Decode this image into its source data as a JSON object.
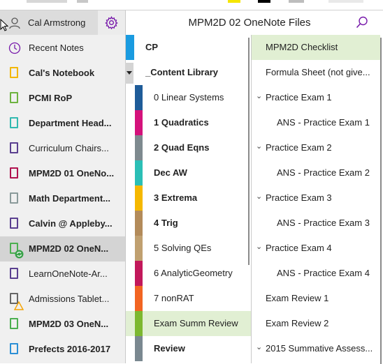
{
  "user": {
    "name": "Cal Armstrong"
  },
  "notebooks": {
    "recent": "Recent Notes",
    "items": [
      {
        "label": "Cal's Notebook",
        "color": "#f3b700",
        "bold": true
      },
      {
        "label": "PCMI RoP",
        "color": "#6db33f",
        "bold": true
      },
      {
        "label": "Department Head...",
        "color": "#32b9b0",
        "bold": true
      },
      {
        "label": "Curriculum Chairs...",
        "color": "#5a3f8f",
        "bold": false
      },
      {
        "label": "MPM2D 01 OneNo...",
        "color": "#b0124f",
        "bold": true
      },
      {
        "label": "Math Department...",
        "color": "#8a9a9a",
        "bold": true
      },
      {
        "label": "Calvin @ Appleby...",
        "color": "#5a3f8f",
        "bold": true
      },
      {
        "label": "MPM2D 02 OneN...",
        "color": "#4caf50",
        "bold": true,
        "selected": true
      },
      {
        "label": "LearnOneNote-Ar...",
        "color": "#5a3f8f",
        "bold": false
      },
      {
        "label": "Admissions Tablet...",
        "color": "#666666",
        "bold": false
      },
      {
        "label": "MPM2D 03 OneN...",
        "color": "#4caf50",
        "bold": true
      },
      {
        "label": "Prefects 2016-2017",
        "color": "#2b8fd6",
        "bold": true
      }
    ]
  },
  "header": {
    "title": "MPM2D 02 OneNote Files"
  },
  "sections": [
    {
      "label": "CP",
      "color": "#1a9be0",
      "bold": true,
      "group": true
    },
    {
      "label": "_Content Library",
      "color": "#f0f0f0",
      "bold": true,
      "group": true
    },
    {
      "label": "0 Linear Systems",
      "color": "#1f5c99",
      "bold": false
    },
    {
      "label": "1 Quadratics",
      "color": "#d4127b",
      "bold": true
    },
    {
      "label": "2 Quad Eqns",
      "color": "#7e8a8f",
      "bold": true
    },
    {
      "label": "Dec AW",
      "color": "#2bbfb6",
      "bold": true
    },
    {
      "label": "3 Extrema",
      "color": "#f5b800",
      "bold": true
    },
    {
      "label": "4 Trig",
      "color": "#b38b5a",
      "bold": true
    },
    {
      "label": "5 Solving QEs",
      "color": "#c0a070",
      "bold": false
    },
    {
      "label": "6 AnalyticGeometry",
      "color": "#c2185b",
      "bold": false
    },
    {
      "label": "7 nonRAT",
      "color": "#f26522",
      "bold": false
    },
    {
      "label": "Exam Summ Review",
      "color": "#7cb82f",
      "bold": false,
      "selected": true
    },
    {
      "label": "Review",
      "color": "#7a8890",
      "bold": true
    }
  ],
  "pages": [
    {
      "label": "MPM2D Checklist",
      "level": 0,
      "selected": true
    },
    {
      "label": "Formula Sheet (not give...",
      "level": 0
    },
    {
      "label": "Practice Exam 1",
      "level": 0,
      "expanded": true
    },
    {
      "label": "ANS - Practice Exam 1",
      "level": 1
    },
    {
      "label": "Practice Exam 2",
      "level": 0,
      "expanded": true
    },
    {
      "label": "ANS - Practice Exam 2",
      "level": 1
    },
    {
      "label": "Practice Exam 3",
      "level": 0,
      "expanded": true
    },
    {
      "label": "ANS - Practice Exam 3",
      "level": 1
    },
    {
      "label": "Practice Exam 4",
      "level": 0,
      "expanded": true
    },
    {
      "label": "ANS - Practice Exam 4",
      "level": 1
    },
    {
      "label": "Exam Review 1",
      "level": 0
    },
    {
      "label": "Exam Review 2",
      "level": 0
    },
    {
      "label": "2015 Summative Assess...",
      "level": 0,
      "expanded": true
    }
  ],
  "colors": {
    "accent": "#7719aa",
    "selected_section_bg": "#e1efd3"
  },
  "icons": {
    "settings": "gear-icon",
    "search": "search-icon",
    "recent": "clock-icon",
    "user": "person-icon"
  }
}
